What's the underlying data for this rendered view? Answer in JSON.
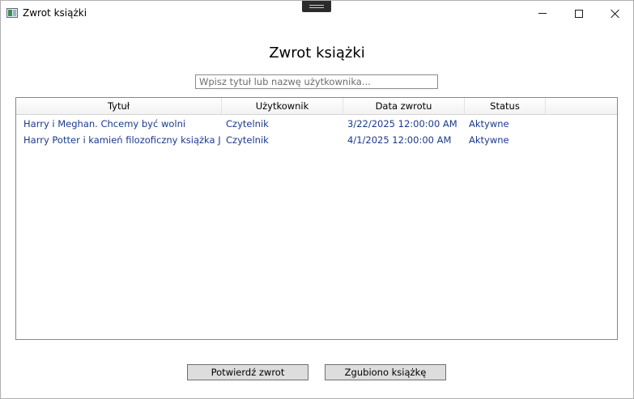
{
  "window": {
    "title": "Zwrot książki",
    "icon": "app-window-icon"
  },
  "page": {
    "heading": "Zwrot książki"
  },
  "search": {
    "placeholder": "Wpisz tytuł lub nazwę użytkownika...",
    "value": ""
  },
  "grid": {
    "columns": [
      "Tytuł",
      "Użytkownik",
      "Data zwrotu",
      "Status"
    ],
    "rows": [
      [
        "Harry i Meghan. Chcemy być wolni",
        "Czytelnik",
        "3/22/2025 12:00:00 AM",
        "Aktywne"
      ],
      [
        "Harry Potter i kamień filozoficzny książka J. K. Rowling",
        "Czytelnik",
        "4/1/2025 12:00:00 AM",
        "Aktywne"
      ]
    ]
  },
  "buttons": {
    "confirm_label": "Potwierdź zwrot",
    "lost_label": "Zgubiono książkę"
  },
  "colors": {
    "cell_text": "#1a3a8c",
    "button_bg": "#dddddd"
  }
}
